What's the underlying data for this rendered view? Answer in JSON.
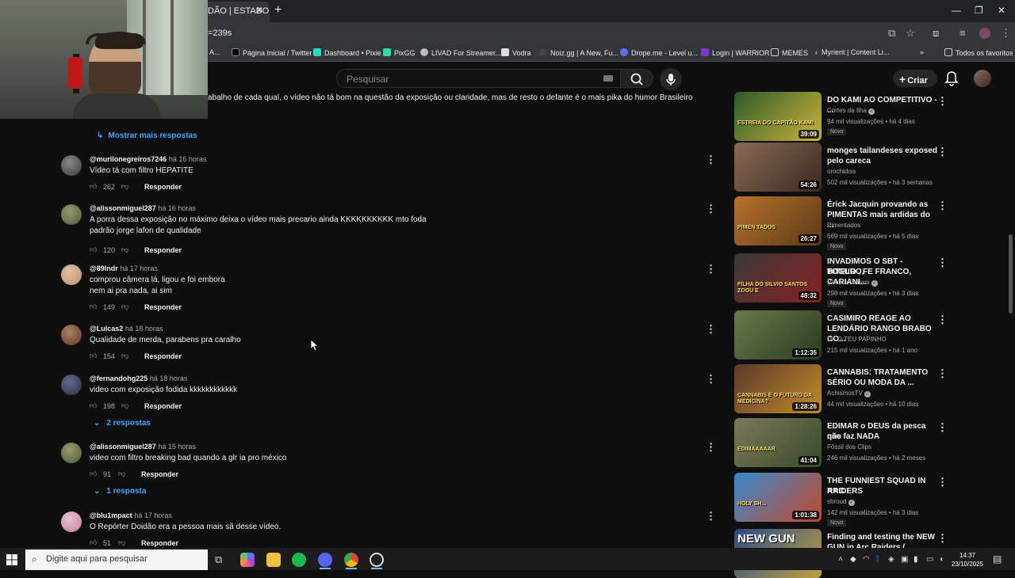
{
  "browser": {
    "tab_title": "DÃO | ESTADOS",
    "url_fragment": "=239s",
    "bookmarks": [
      "Página Inicial / Twitter",
      "Dashboard • Pixie",
      "PixGG",
      "LIVAD For Streamer...",
      "Vodra",
      "Noiz.gg | A New, Fu...",
      "Drope.me - Level u...",
      "Login | WARRIOR",
      "MEMES",
      "Myrient | Content Li..."
    ],
    "bookmark_prefix": "A...",
    "favorites_label": "Todos os favoritos"
  },
  "header": {
    "search_placeholder": "Pesquisar",
    "create_label": "Criar"
  },
  "top_comment_tail": "abalho de cada qual, o vídeo não tá bom na questão da exposição ou claridade, mas de resto o defante é o mais pika do humor Brasileiro",
  "show_more_replies": "Mostrar mais respostas",
  "comments": [
    {
      "author": "@murilonegreiros7246",
      "time": "há 16 horas",
      "lines": [
        "Vídeo tá com filtro HEPATITE"
      ],
      "likes": "262",
      "reply": "Responder"
    },
    {
      "author": "@alissonmiguel287",
      "time": "há 16 horas",
      "lines": [
        "A porra dessa exposição no máximo deixa o vídeo mais precario ainda KKKKKKKKKK mto foda",
        "padrão jorge lafon de qualidade"
      ],
      "likes": "120",
      "reply": "Responder"
    },
    {
      "author": "@89lndr",
      "time": "há 17 horas",
      "lines": [
        "comprou câmera lá, ligou e foi embora",
        "nem ai pra nada, ai sim"
      ],
      "likes": "149",
      "reply": "Responder"
    },
    {
      "author": "@Lulcas2",
      "time": "há 18 horas",
      "lines": [
        "Qualidade de merda, parabens pra caralho"
      ],
      "likes": "154",
      "reply": "Responder"
    },
    {
      "author": "@fernandohg225",
      "time": "há 18 horas",
      "lines": [
        "video com exposição fodida kkkkkkkkkkkk"
      ],
      "likes": "198",
      "reply": "Responder",
      "replies_label": "2 respostas"
    },
    {
      "author": "@alissonmiguel287",
      "time": "há 15 horas",
      "lines": [
        "video com filtro breaking bad quando a glr ia pro méxico"
      ],
      "likes": "91",
      "reply": "Responder",
      "replies_label": "1 resposta"
    },
    {
      "author": "@blu1mpact",
      "time": "há 17 horas",
      "lines": [
        "O Repórter Doidão era a pessoa mais sã desse vídeo."
      ],
      "likes": "51",
      "reply": "Responder"
    }
  ],
  "recommendations": [
    {
      "title_lines": [
        "DO KAMI AO COMPETITIVO - ..."
      ],
      "channel": "Cortes da Ilha",
      "verified": true,
      "stats": "94 mil visualizações • há 4 dias",
      "badge": "Novo",
      "duration": "39:09",
      "thumb_text": "ESTREIA DO CAPITÃO KAMI",
      "colors": [
        "#2e5a2a",
        "#c9b43a"
      ]
    },
    {
      "title_lines": [
        "monges tailandeses exposed",
        "pelo careca"
      ],
      "channel": "orochidois",
      "verified": false,
      "stats": "502 mil visualizações • há 3 semanas",
      "badge": "",
      "duration": "54:26",
      "thumb_text": "",
      "colors": [
        "#8a6a52",
        "#3a2a22"
      ]
    },
    {
      "title_lines": [
        "Érick Jacquin provando as",
        "PIMENTAS mais ardidas do ..."
      ],
      "channel": "Pimentados",
      "verified": false,
      "stats": "669 mil visualizações • há 5 dias",
      "badge": "Novo",
      "duration": "26:27",
      "thumb_text": "PIMEN TADOS",
      "colors": [
        "#b8722a",
        "#5a3a1a"
      ]
    },
    {
      "title_lines": [
        "INVADIMOS O SBT - TOGURO,",
        "BITELO , FE FRANCO, CARIANI..."
      ],
      "channel": "Renato Cariani",
      "verified": true,
      "stats": "298 mil visualizações • há 3 dias",
      "badge": "Novo",
      "duration": "48:32",
      "thumb_text": "FILHA DO SILVIO SANTOS ZOOU E",
      "colors": [
        "#3a3a3a",
        "#8a2020"
      ]
    },
    {
      "title_lines": [
        "CASIMIRO REAGE AO",
        "LENDÁRIO RANGO BRABO CO..."
      ],
      "channel": "DA O TEU PAPINHO",
      "verified": false,
      "stats": "215 mil visualizações • há 1 ano",
      "badge": "",
      "duration": "1:12:35",
      "thumb_text": "",
      "colors": [
        "#6a7a4a",
        "#2a3a22"
      ]
    },
    {
      "title_lines": [
        "CANNABIS: TRATAMENTO",
        "SÉRIO OU MODA DA ..."
      ],
      "channel": "AchismosTV",
      "verified": true,
      "stats": "44 mil visualizações • há 10 dias",
      "badge": "",
      "duration": "1:28:26",
      "thumb_text": "CANNABIS É O FUTURO DA MEDICINA?",
      "colors": [
        "#5a3a2a",
        "#c48a2a"
      ]
    },
    {
      "title_lines": [
        "EDIMAR o DEUS da pesca que",
        "não faz NADA"
      ],
      "channel": "Fóssil dos Clips",
      "verified": false,
      "stats": "246 mil visualizações • há 2 meses",
      "badge": "",
      "duration": "41:04",
      "thumb_text": "EDIMAAAAAR",
      "colors": [
        "#7a7a5a",
        "#3a4a2a"
      ]
    },
    {
      "title_lines": [
        "THE FUNNIEST SQUAD IN ARC",
        "RAIDERS"
      ],
      "channel": "shroud",
      "verified": true,
      "stats": "142 mil visualizações • há 3 dias",
      "badge": "Novo",
      "duration": "1:01:38",
      "thumb_text": "HOLY SH...",
      "colors": [
        "#3a8ad0",
        "#c04a2a"
      ]
    },
    {
      "title_lines": [
        "Finding and testing the NEW",
        "GUN in Arc Raiders ( BETTINA )"
      ],
      "channel": "",
      "verified": false,
      "stats": "",
      "badge": "",
      "duration": "",
      "thumb_text": "NEW GUN",
      "colors": [
        "#2a4a8a",
        "#c0a040"
      ]
    }
  ],
  "taskbar": {
    "search_placeholder": "Digite aqui para pesquisar",
    "time": "14:37",
    "date": "23/10/2025"
  }
}
